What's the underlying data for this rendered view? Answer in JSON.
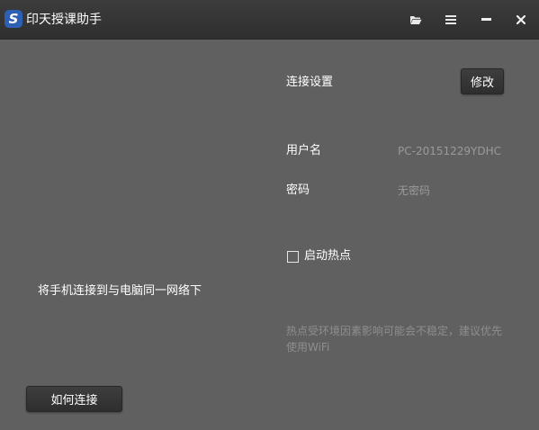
{
  "window": {
    "title": "印天授课助手",
    "logo_letter": "S"
  },
  "titlebar": {
    "folder_icon": "folder-icon",
    "menu_icon": "menu-icon",
    "minimize_icon": "minimize-icon",
    "close_icon": "close-icon"
  },
  "left": {
    "instruction": "将手机连接到与电脑同一网络下",
    "how_to_connect_label": "如何连接"
  },
  "settings": {
    "section_title": "连接设置",
    "modify_label": "修改",
    "username_label": "用户名",
    "username_value": "PC-20151229YDHC",
    "password_label": "密码",
    "password_value": "无密码",
    "hotspot_label": "启动热点",
    "hotspot_checked": false,
    "hint": "热点受环境因素影响可能会不稳定，建议优先使用WiFi"
  },
  "colors": {
    "titlebar": "#333333",
    "background": "#606060",
    "button": "#363636",
    "logo": "#2d5fb5",
    "label": "#ffffff",
    "muted": "#9a9a9a"
  }
}
